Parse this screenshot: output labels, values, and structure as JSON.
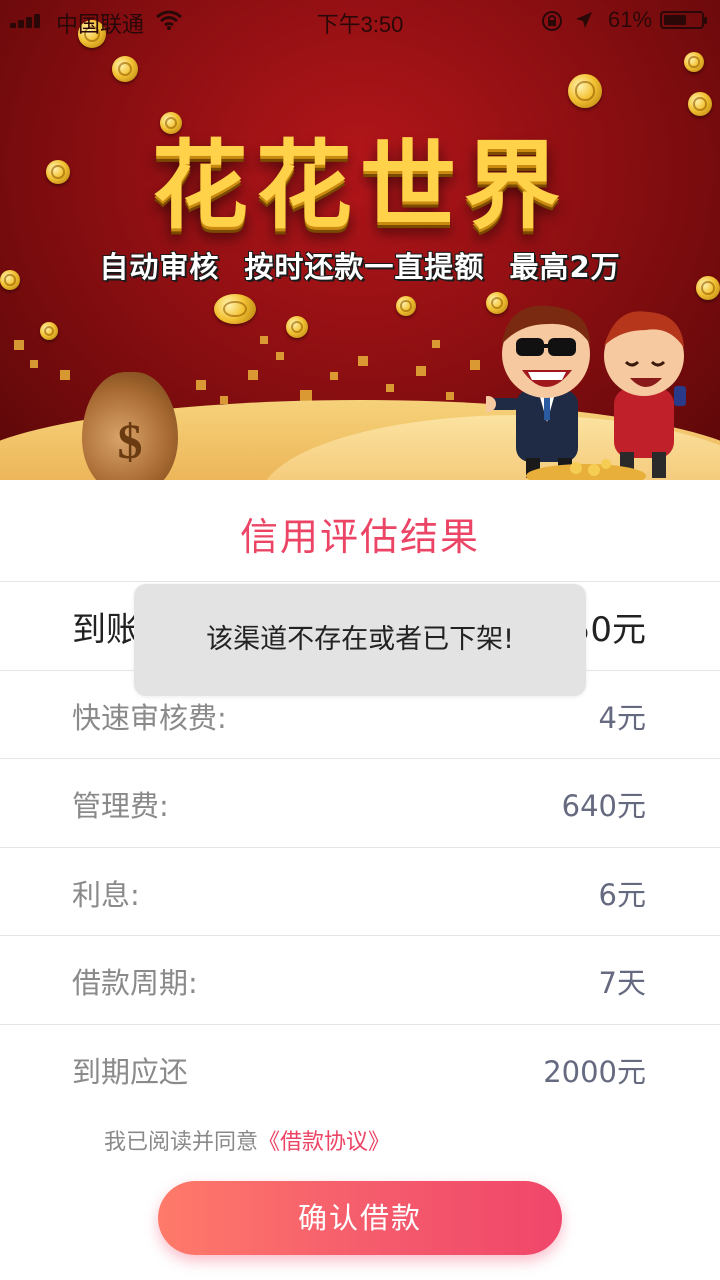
{
  "status_bar": {
    "carrier": "中国联通",
    "time": "下午3:50",
    "battery": "61%",
    "battery_level": 0.61
  },
  "banner": {
    "title": "花花世界",
    "subtitle": "自动审核  按时还款一直提额  最高2万"
  },
  "result": {
    "title": "信用评估结果",
    "rows": [
      {
        "label": "到账金额",
        "value": "1350元"
      },
      {
        "label": "快速审核费:",
        "value": "4元"
      },
      {
        "label": "管理费:",
        "value": "640元"
      },
      {
        "label": "利息:",
        "value": "6元"
      },
      {
        "label": "借款周期:",
        "value": "7天"
      },
      {
        "label": "到期应还",
        "value": "2000元"
      }
    ]
  },
  "agreement": {
    "prefix": "我已阅读并同意",
    "link": "《借款协议》"
  },
  "confirm_button": "确认借款",
  "toast": "该渠道不存在或者已下架!",
  "colors": {
    "accent": "#ec4465",
    "banner_red": "#8e0f12",
    "gold": "#ffd24a"
  }
}
